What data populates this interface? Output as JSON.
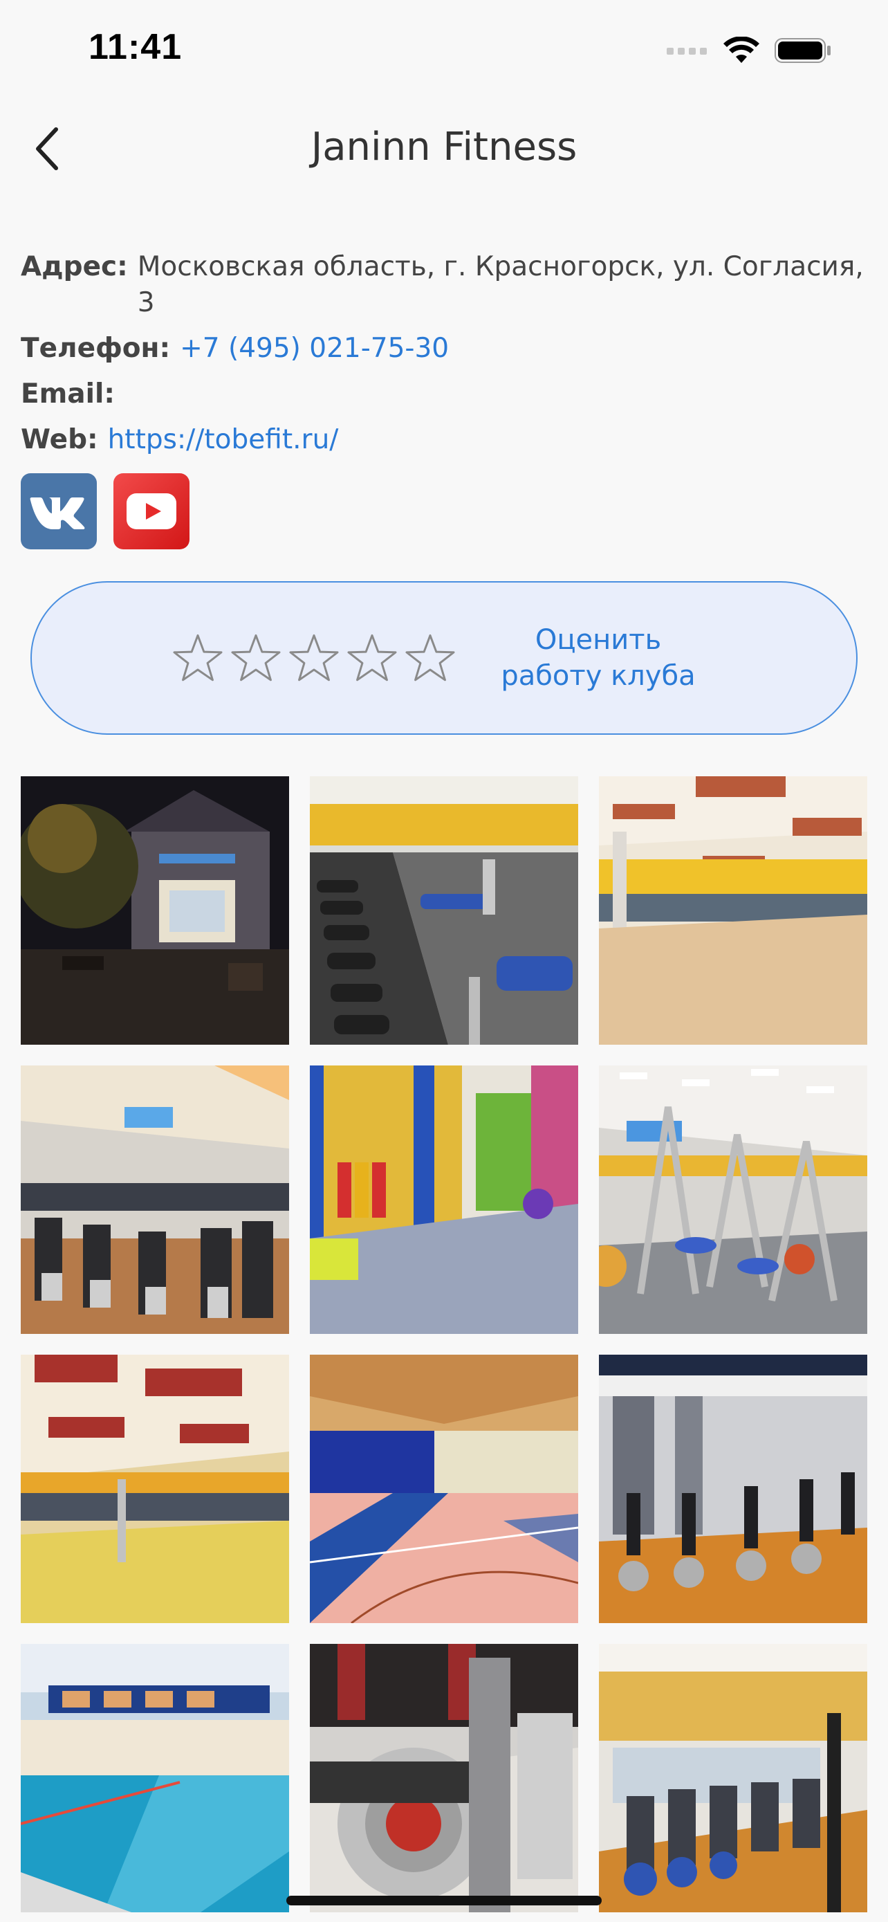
{
  "status": {
    "time": "11:41"
  },
  "nav": {
    "title": "Janinn Fitness"
  },
  "info": {
    "address_label": "Адрес:",
    "address_value": "Московская область, г. Красногорск, ул. Согласия, 3",
    "phone_label": "Телефон:",
    "phone_value": "+7 (495) 021-75-30",
    "email_label": "Email:",
    "email_value": "",
    "web_label": "Web:",
    "web_value": "https://tobefit.ru/"
  },
  "social": {
    "vk_icon": "vk-icon",
    "youtube_icon": "youtube-icon"
  },
  "rating": {
    "stars_total": 5,
    "stars_filled": 0,
    "label": "Оценить работу клуба"
  },
  "gallery": {
    "photos": [
      {
        "name": "club-exterior-night"
      },
      {
        "name": "dumbbell-rack-room"
      },
      {
        "name": "dance-hall"
      },
      {
        "name": "cardio-hall-mirrors"
      },
      {
        "name": "kids-playroom"
      },
      {
        "name": "strength-machines-hall"
      },
      {
        "name": "aerobics-studio"
      },
      {
        "name": "sports-court"
      },
      {
        "name": "cycling-studio"
      },
      {
        "name": "swimming-pool"
      },
      {
        "name": "spin-bike-closeup"
      },
      {
        "name": "treadmill-row"
      }
    ]
  },
  "colors": {
    "accent": "#2a7ad6",
    "vk": "#4a76a8",
    "youtube": "#e62b2b",
    "rating_bg": "#e9eefb"
  }
}
